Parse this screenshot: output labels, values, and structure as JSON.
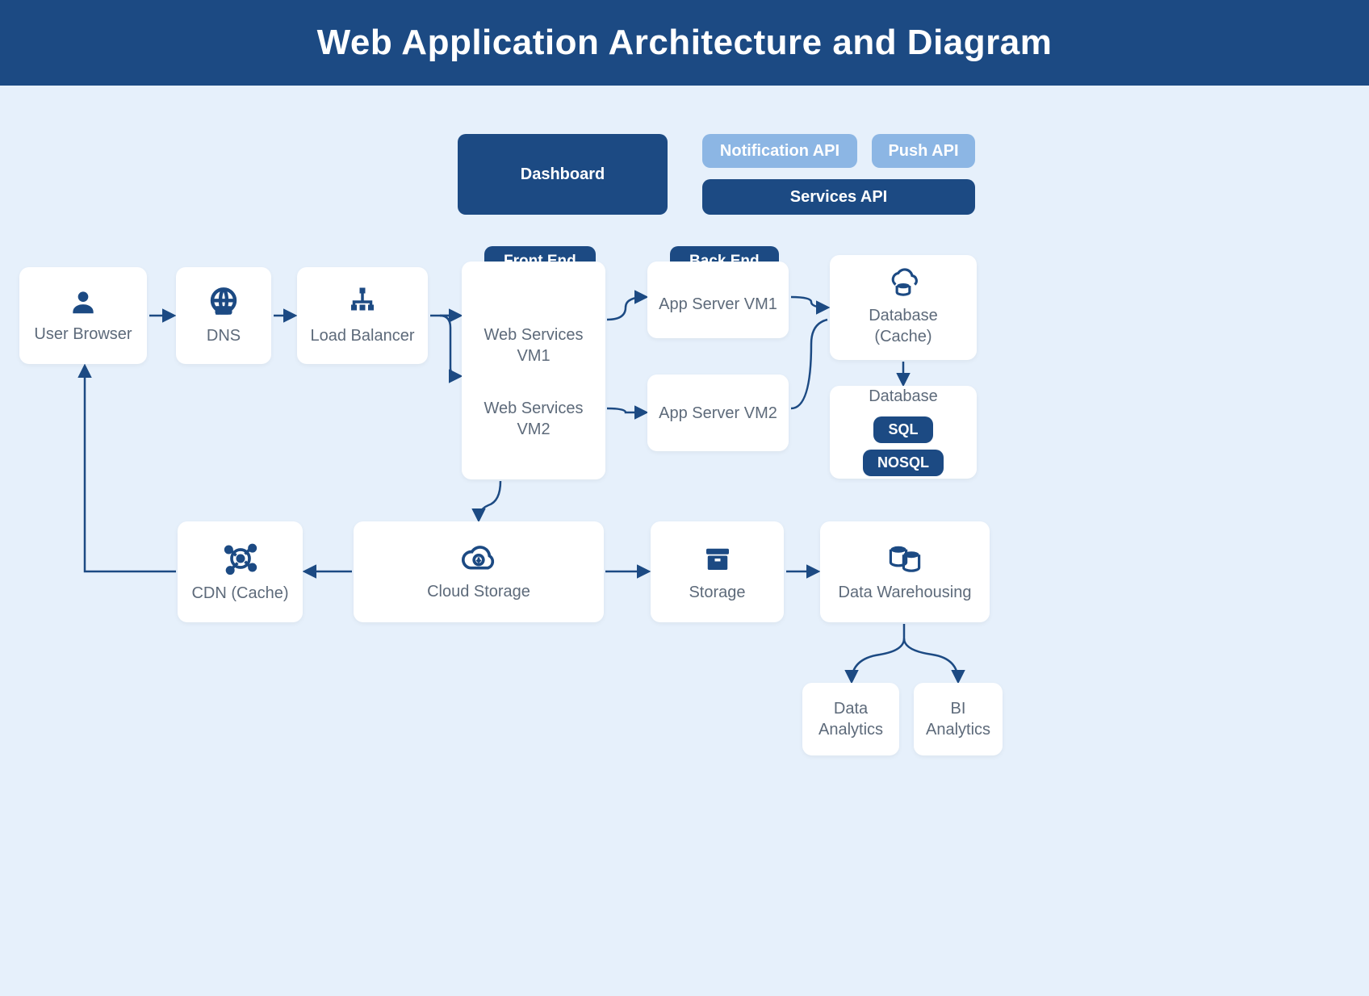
{
  "title": "Web Application Architecture and Diagram",
  "nodes": {
    "user_browser": "User Browser",
    "dns": "DNS",
    "load_balancer": "Load Balancer",
    "dashboard": "Dashboard",
    "notification_api": "Notification API",
    "push_api": "Push API",
    "services_api": "Services API",
    "front_end": "Front End",
    "web_services_vm1": "Web Services VM1",
    "web_services_vm2": "Web Services VM2",
    "back_end": "Back End",
    "app_server_vm1": "App Server VM1",
    "app_server_vm2": "App Server VM2",
    "database_cache": "Database (Cache)",
    "database": "Database",
    "sql": "SQL",
    "nosql": "NOSQL",
    "cdn_cache": "CDN (Cache)",
    "cloud_storage": "Cloud Storage",
    "storage": "Storage",
    "data_warehousing": "Data Warehousing",
    "data_analytics": "Data Analytics",
    "bi_analytics": "BI Analytics"
  },
  "icons": {
    "user": "user-icon",
    "dns": "dns-globe-icon",
    "load_balancer": "load-balancer-icon",
    "database_cache": "cloud-database-icon",
    "cdn": "cdn-node-icon",
    "cloud_storage": "cloud-download-icon",
    "storage": "storage-box-icon",
    "data_warehouse": "data-warehouse-icon"
  },
  "colors": {
    "navy": "#1c4a83",
    "navy_light": "#8cb6e4",
    "background": "#e6f0fb",
    "card": "#ffffff",
    "text": "#5d6a7a"
  },
  "edges": [
    [
      "user_browser",
      "dns"
    ],
    [
      "dns",
      "load_balancer"
    ],
    [
      "load_balancer",
      "front_end"
    ],
    [
      "front_end",
      "app_server_vm1"
    ],
    [
      "front_end",
      "app_server_vm2"
    ],
    [
      "app_server_vm1",
      "database_cache"
    ],
    [
      "app_server_vm2",
      "database_cache"
    ],
    [
      "database_cache",
      "database"
    ],
    [
      "front_end",
      "cloud_storage"
    ],
    [
      "cloud_storage",
      "cdn_cache"
    ],
    [
      "cdn_cache",
      "user_browser"
    ],
    [
      "cloud_storage",
      "storage"
    ],
    [
      "storage",
      "data_warehousing"
    ],
    [
      "data_warehousing",
      "data_analytics"
    ],
    [
      "data_warehousing",
      "bi_analytics"
    ]
  ]
}
